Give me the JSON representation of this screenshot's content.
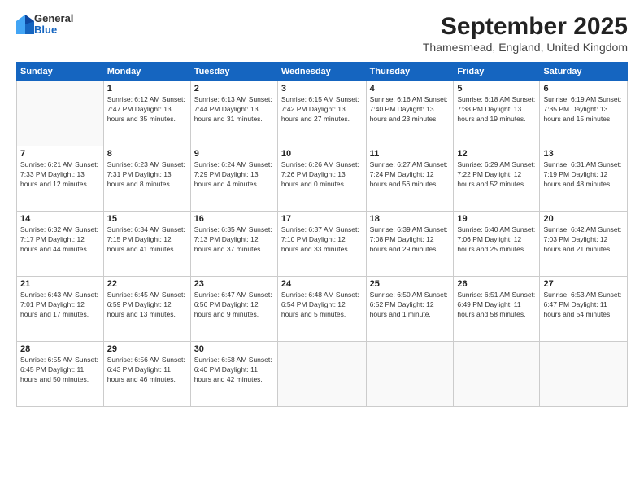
{
  "header": {
    "logo": {
      "general": "General",
      "blue": "Blue"
    },
    "title": "September 2025",
    "location": "Thamesmead, England, United Kingdom"
  },
  "calendar": {
    "days_of_week": [
      "Sunday",
      "Monday",
      "Tuesday",
      "Wednesday",
      "Thursday",
      "Friday",
      "Saturday"
    ],
    "weeks": [
      [
        {
          "day": "",
          "info": ""
        },
        {
          "day": "1",
          "info": "Sunrise: 6:12 AM\nSunset: 7:47 PM\nDaylight: 13 hours\nand 35 minutes."
        },
        {
          "day": "2",
          "info": "Sunrise: 6:13 AM\nSunset: 7:44 PM\nDaylight: 13 hours\nand 31 minutes."
        },
        {
          "day": "3",
          "info": "Sunrise: 6:15 AM\nSunset: 7:42 PM\nDaylight: 13 hours\nand 27 minutes."
        },
        {
          "day": "4",
          "info": "Sunrise: 6:16 AM\nSunset: 7:40 PM\nDaylight: 13 hours\nand 23 minutes."
        },
        {
          "day": "5",
          "info": "Sunrise: 6:18 AM\nSunset: 7:38 PM\nDaylight: 13 hours\nand 19 minutes."
        },
        {
          "day": "6",
          "info": "Sunrise: 6:19 AM\nSunset: 7:35 PM\nDaylight: 13 hours\nand 15 minutes."
        }
      ],
      [
        {
          "day": "7",
          "info": "Sunrise: 6:21 AM\nSunset: 7:33 PM\nDaylight: 13 hours\nand 12 minutes."
        },
        {
          "day": "8",
          "info": "Sunrise: 6:23 AM\nSunset: 7:31 PM\nDaylight: 13 hours\nand 8 minutes."
        },
        {
          "day": "9",
          "info": "Sunrise: 6:24 AM\nSunset: 7:29 PM\nDaylight: 13 hours\nand 4 minutes."
        },
        {
          "day": "10",
          "info": "Sunrise: 6:26 AM\nSunset: 7:26 PM\nDaylight: 13 hours\nand 0 minutes."
        },
        {
          "day": "11",
          "info": "Sunrise: 6:27 AM\nSunset: 7:24 PM\nDaylight: 12 hours\nand 56 minutes."
        },
        {
          "day": "12",
          "info": "Sunrise: 6:29 AM\nSunset: 7:22 PM\nDaylight: 12 hours\nand 52 minutes."
        },
        {
          "day": "13",
          "info": "Sunrise: 6:31 AM\nSunset: 7:19 PM\nDaylight: 12 hours\nand 48 minutes."
        }
      ],
      [
        {
          "day": "14",
          "info": "Sunrise: 6:32 AM\nSunset: 7:17 PM\nDaylight: 12 hours\nand 44 minutes."
        },
        {
          "day": "15",
          "info": "Sunrise: 6:34 AM\nSunset: 7:15 PM\nDaylight: 12 hours\nand 41 minutes."
        },
        {
          "day": "16",
          "info": "Sunrise: 6:35 AM\nSunset: 7:13 PM\nDaylight: 12 hours\nand 37 minutes."
        },
        {
          "day": "17",
          "info": "Sunrise: 6:37 AM\nSunset: 7:10 PM\nDaylight: 12 hours\nand 33 minutes."
        },
        {
          "day": "18",
          "info": "Sunrise: 6:39 AM\nSunset: 7:08 PM\nDaylight: 12 hours\nand 29 minutes."
        },
        {
          "day": "19",
          "info": "Sunrise: 6:40 AM\nSunset: 7:06 PM\nDaylight: 12 hours\nand 25 minutes."
        },
        {
          "day": "20",
          "info": "Sunrise: 6:42 AM\nSunset: 7:03 PM\nDaylight: 12 hours\nand 21 minutes."
        }
      ],
      [
        {
          "day": "21",
          "info": "Sunrise: 6:43 AM\nSunset: 7:01 PM\nDaylight: 12 hours\nand 17 minutes."
        },
        {
          "day": "22",
          "info": "Sunrise: 6:45 AM\nSunset: 6:59 PM\nDaylight: 12 hours\nand 13 minutes."
        },
        {
          "day": "23",
          "info": "Sunrise: 6:47 AM\nSunset: 6:56 PM\nDaylight: 12 hours\nand 9 minutes."
        },
        {
          "day": "24",
          "info": "Sunrise: 6:48 AM\nSunset: 6:54 PM\nDaylight: 12 hours\nand 5 minutes."
        },
        {
          "day": "25",
          "info": "Sunrise: 6:50 AM\nSunset: 6:52 PM\nDaylight: 12 hours\nand 1 minute."
        },
        {
          "day": "26",
          "info": "Sunrise: 6:51 AM\nSunset: 6:49 PM\nDaylight: 11 hours\nand 58 minutes."
        },
        {
          "day": "27",
          "info": "Sunrise: 6:53 AM\nSunset: 6:47 PM\nDaylight: 11 hours\nand 54 minutes."
        }
      ],
      [
        {
          "day": "28",
          "info": "Sunrise: 6:55 AM\nSunset: 6:45 PM\nDaylight: 11 hours\nand 50 minutes."
        },
        {
          "day": "29",
          "info": "Sunrise: 6:56 AM\nSunset: 6:43 PM\nDaylight: 11 hours\nand 46 minutes."
        },
        {
          "day": "30",
          "info": "Sunrise: 6:58 AM\nSunset: 6:40 PM\nDaylight: 11 hours\nand 42 minutes."
        },
        {
          "day": "",
          "info": ""
        },
        {
          "day": "",
          "info": ""
        },
        {
          "day": "",
          "info": ""
        },
        {
          "day": "",
          "info": ""
        }
      ]
    ]
  }
}
